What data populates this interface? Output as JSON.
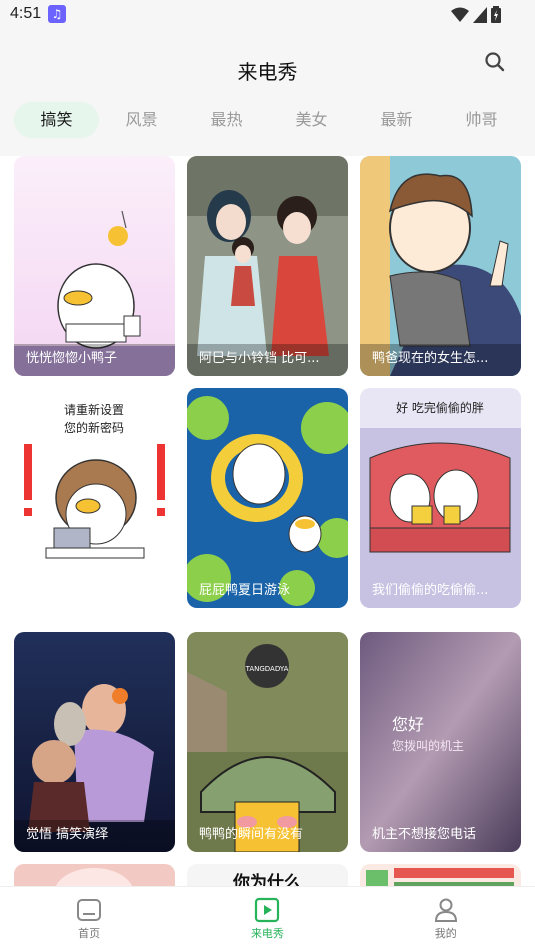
{
  "status_bar": {
    "time": "4:51",
    "app_icon": "music-note-icon"
  },
  "header": {
    "title": "来电秀",
    "search_icon": "search-icon"
  },
  "tabs": [
    {
      "label": "搞笑",
      "active": true
    },
    {
      "label": "风景",
      "active": false
    },
    {
      "label": "最热",
      "active": false
    },
    {
      "label": "美女",
      "active": false
    },
    {
      "label": "最新",
      "active": false
    },
    {
      "label": "帅哥",
      "active": false
    }
  ],
  "cards": [
    {
      "title": "恍恍惚惚小鸭子"
    },
    {
      "title": "阿巳与小铃铛 比可..."
    },
    {
      "title": "鸭爸现在的女生怎..."
    },
    {
      "title": ""
    },
    {
      "title": "屁屁鸭夏日游泳"
    },
    {
      "title": "我们偷偷的吃偷偷..."
    },
    {
      "title": "觉悟 搞笑演绎"
    },
    {
      "title": "鸭鸭的瞬间有没有"
    },
    {
      "title": "机主不想接您电话"
    }
  ],
  "card_texts": {
    "password_line1": "请重新设置",
    "password_line2": "您的新密码",
    "eat_caption": "好  吃完偷偷的胖",
    "brand_logo": "TANGDADYA",
    "hello_line1": "您好",
    "hello_line2": "您拨叫的机主",
    "peek_caption": "你为什么"
  },
  "bottom_nav": [
    {
      "label": "首页",
      "icon": "home-icon",
      "active": false
    },
    {
      "label": "来电秀",
      "icon": "play-video-icon",
      "active": true
    },
    {
      "label": "我的",
      "icon": "profile-icon",
      "active": false
    }
  ],
  "colors": {
    "accent": "#27b35a",
    "active_tab_bg": "#e6f6ec",
    "header_bg": "#f5f6f5"
  }
}
